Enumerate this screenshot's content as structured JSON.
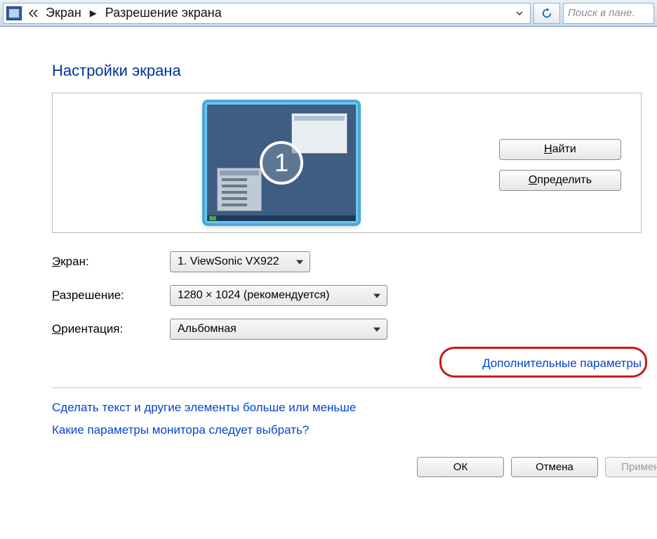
{
  "breadcrumb": {
    "item1": "Экран",
    "item2": "Разрешение экрана"
  },
  "search": {
    "placeholder": "Поиск в пане."
  },
  "title": "Настройки экрана",
  "display_number": "1",
  "buttons": {
    "find_prefix": "Н",
    "find_rest": "айти",
    "identify_prefix": "О",
    "identify_rest": "пределить"
  },
  "labels": {
    "screen_prefix": "Э",
    "screen_rest": "кран:",
    "resolution_prefix": "Р",
    "resolution_rest": "азрешение:",
    "orientation_prefix": "О",
    "orientation_rest": "риентация:"
  },
  "values": {
    "screen": "1. ViewSonic VX922",
    "resolution": "1280 × 1024 (рекомендуется)",
    "orientation": "Альбомная"
  },
  "links": {
    "advanced": "Дополнительные параметры",
    "textsize": "Сделать текст и другие элементы больше или меньше",
    "which": "Какие параметры монитора следует выбрать?"
  },
  "footer": {
    "ok": "ОК",
    "cancel": "Отмена",
    "apply": "Применить"
  }
}
